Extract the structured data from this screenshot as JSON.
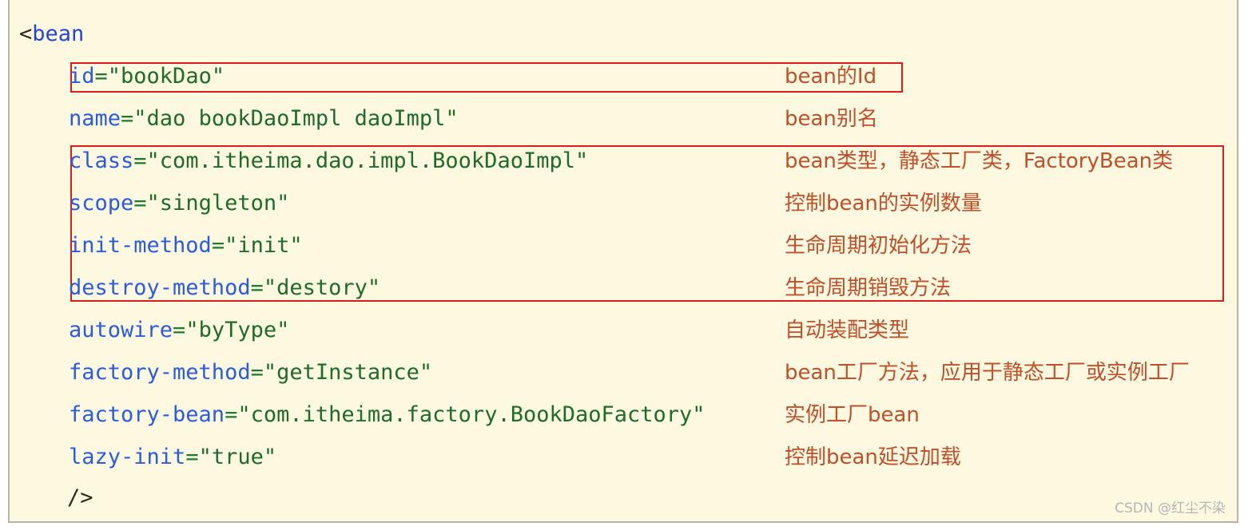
{
  "colors": {
    "background": "#fdf8e0",
    "panel_border": "#b9b5a4",
    "tag_name": "#2346d6",
    "attr_name": "#2a5be0",
    "attr_value": "#1f6b2a",
    "equals": "#1f7a2e",
    "punctuation": "#33281c",
    "annotation": "#c0502a",
    "highlight_box": "#e01b1b",
    "watermark": "#b6b6b6"
  },
  "code": {
    "open_tag_punct": "<",
    "open_tag_name": "bean",
    "close_tag": "/>",
    "attributes": [
      {
        "name": "id",
        "eq": "=",
        "value": "\"bookDao\"",
        "note": "bean的Id",
        "highlighted": true
      },
      {
        "name": "name",
        "eq": "=",
        "value": "\"dao bookDaoImpl daoImpl\"",
        "note": "bean别名",
        "highlighted": false
      },
      {
        "name": "class",
        "eq": "=",
        "value": "\"com.itheima.dao.impl.BookDaoImpl\"",
        "note": "bean类型，静态工厂类，FactoryBean类",
        "highlighted": true
      },
      {
        "name": "scope",
        "eq": "=",
        "value": "\"singleton\"",
        "note": "控制bean的实例数量",
        "highlighted": true
      },
      {
        "name": "init-method",
        "eq": "=",
        "value": "\"init\"",
        "note": "生命周期初始化方法",
        "highlighted": true
      },
      {
        "name": "destroy-method",
        "eq": "=",
        "value": "\"destory\"",
        "note": "生命周期销毁方法",
        "highlighted": true
      },
      {
        "name": "autowire",
        "eq": "=",
        "value": "\"byType\"",
        "note": "自动装配类型",
        "highlighted": false
      },
      {
        "name": "factory-method",
        "eq": "=",
        "value": "\"getInstance\"",
        "note": "bean工厂方法，应用于静态工厂或实例工厂",
        "highlighted": false
      },
      {
        "name": "factory-bean",
        "eq": "=",
        "value": "\"com.itheima.factory.BookDaoFactory\"",
        "note": "实例工厂bean",
        "highlighted": false
      },
      {
        "name": "lazy-init",
        "eq": "=",
        "value": "\"true\"",
        "note": "控制bean延迟加载",
        "highlighted": false
      }
    ]
  },
  "watermark": {
    "text": "CSDN @红尘不染"
  }
}
